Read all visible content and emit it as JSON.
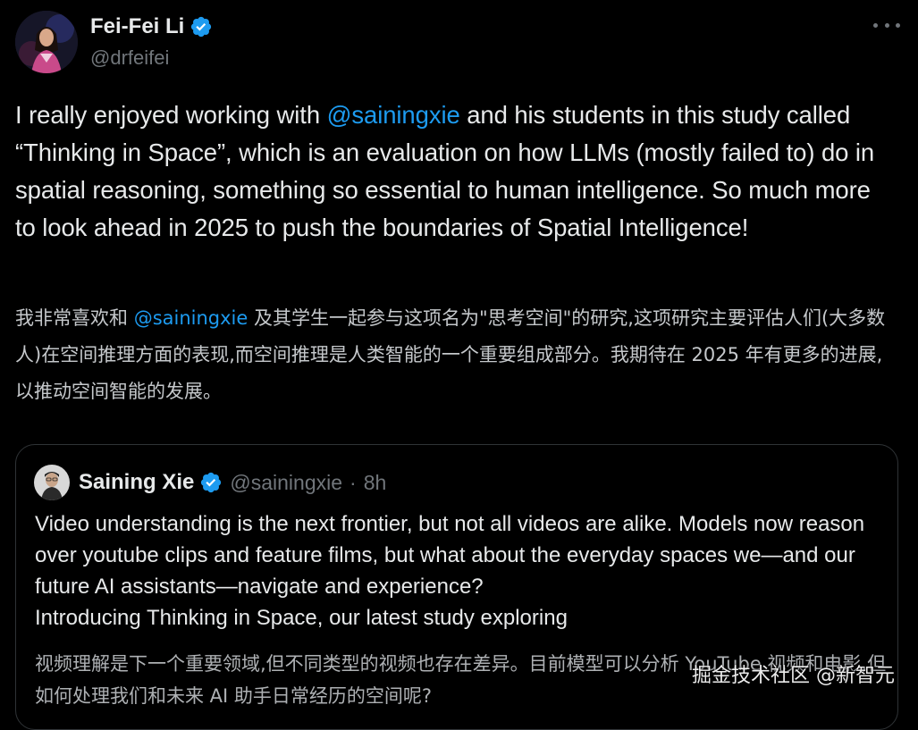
{
  "tweet": {
    "author": {
      "display_name": "Fei-Fei Li",
      "handle": "@drfeifei",
      "verified_icon": "verified-badge-icon"
    },
    "more_icon": "more-options-icon",
    "text_en": {
      "part1": "I really enjoyed working with ",
      "mention": "@sainingxie",
      "part2": " and his students in this study called “Thinking in Space”, which is an evaluation on how LLMs (mostly failed to) do in spatial reasoning, something so essential to human intelligence. So much more to look ahead in 2025 to push the boundaries of Spatial Intelligence!"
    },
    "text_zh": {
      "part1": "我非常喜欢和 ",
      "mention": "@sainingxie",
      "part2": " 及其学生一起参与这项名为\"思考空间\"的研究,这项研究主要评估人们(大多数人)在空间推理方面的表现,而空间推理是人类智能的一个重要组成部分。我期待在 2025 年有更多的进展,以推动空间智能的发展。"
    }
  },
  "quoted_tweet": {
    "author": {
      "display_name": "Saining Xie",
      "handle": "@sainingxie",
      "separator": "·",
      "time": "8h"
    },
    "text_en_lines": [
      "Video understanding is the next frontier, but not all videos are alike. Models now reason over youtube clips and feature films, but what about the everyday spaces we—and our future AI assistants—navigate and experience?",
      "Introducing Thinking in Space, our latest study exploring"
    ],
    "text_zh": "视频理解是下一个重要领域,但不同类型的视频也存在差异。目前模型可以分析 YouTube 视频和电影,但如何处理我们和未来 AI 助手日常经历的空间呢?"
  },
  "watermark": "掘金技术社区 @新智元",
  "colors": {
    "background": "#000000",
    "text": "#e7e9ea",
    "secondary": "#71767b",
    "link": "#1d9bf0",
    "verified": "#1d9bf0",
    "border": "#2f3336"
  }
}
